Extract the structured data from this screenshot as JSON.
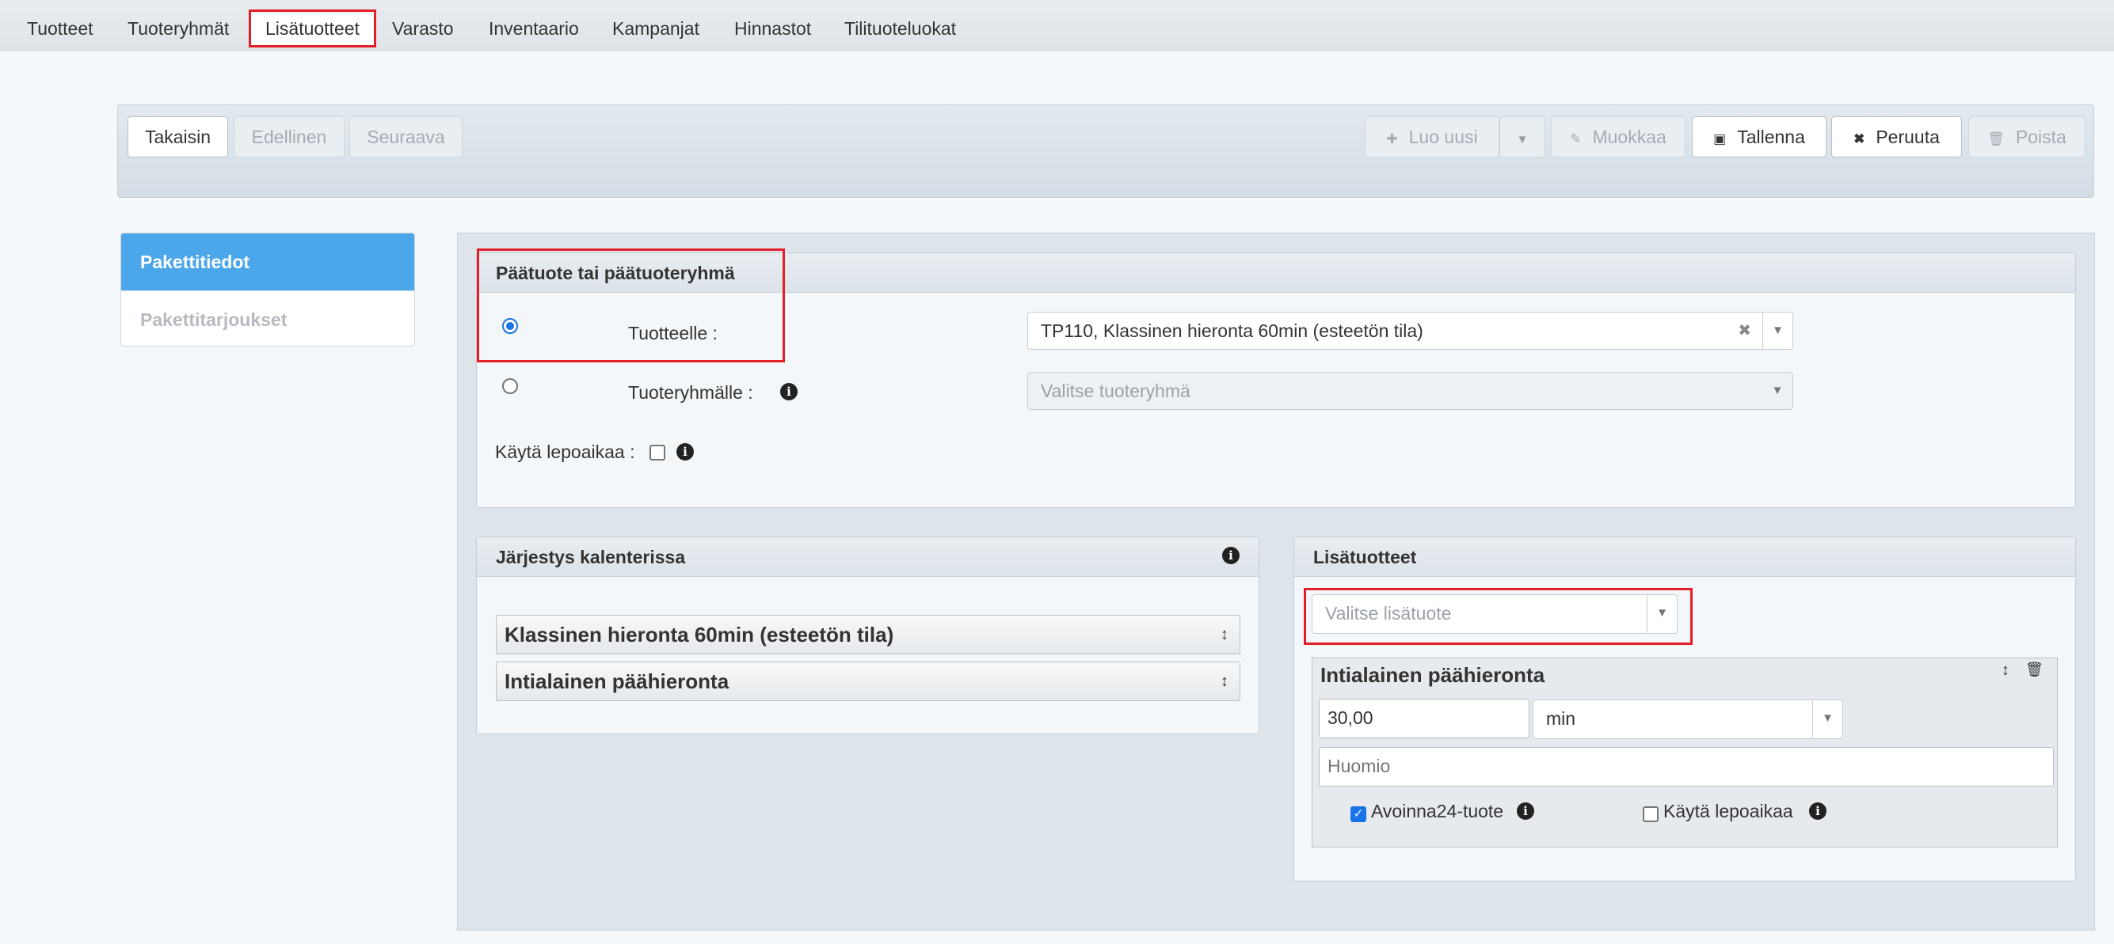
{
  "nav": {
    "tabs": [
      "Tuotteet",
      "Tuoteryhmät",
      "Lisätuotteet",
      "Varasto",
      "Inventaario",
      "Kampanjat",
      "Hinnastot",
      "Tilituoteluokat"
    ]
  },
  "toolbar": {
    "back": "Takaisin",
    "previous": "Edellinen",
    "next": "Seuraava",
    "create_new": "Luo uusi",
    "edit": "Muokkaa",
    "save": "Tallenna",
    "cancel": "Peruuta",
    "delete": "Poista"
  },
  "sidebar": {
    "items": [
      "Pakettitiedot",
      "Pakettitarjoukset"
    ]
  },
  "main_product": {
    "header": "Päätuote tai päätuoteryhmä",
    "product_label": "Tuotteelle :",
    "product_value": "TP110, Klassinen hieronta 60min (esteetön tila)",
    "group_label": "Tuoteryhmälle :",
    "group_placeholder": "Valitse tuoteryhmä",
    "rest_label": "Käytä lepoaikaa :"
  },
  "calendar_order": {
    "header": "Järjestys kalenterissa",
    "items": [
      "Klassinen hieronta 60min (esteetön tila)",
      "Intialainen päähieronta"
    ]
  },
  "addons": {
    "header": "Lisätuotteet",
    "select_placeholder": "Valitse lisätuote",
    "item": {
      "title": "Intialainen päähieronta",
      "duration": "30,00",
      "unit": "min",
      "note_placeholder": "Huomio",
      "open24_label": "Avoinna24-tuote",
      "open24_checked": true,
      "rest_label": "Käytä lepoaikaa",
      "rest_checked": false
    }
  },
  "colors": {
    "highlight": "#e41e26",
    "accent": "#4ca7ea"
  }
}
